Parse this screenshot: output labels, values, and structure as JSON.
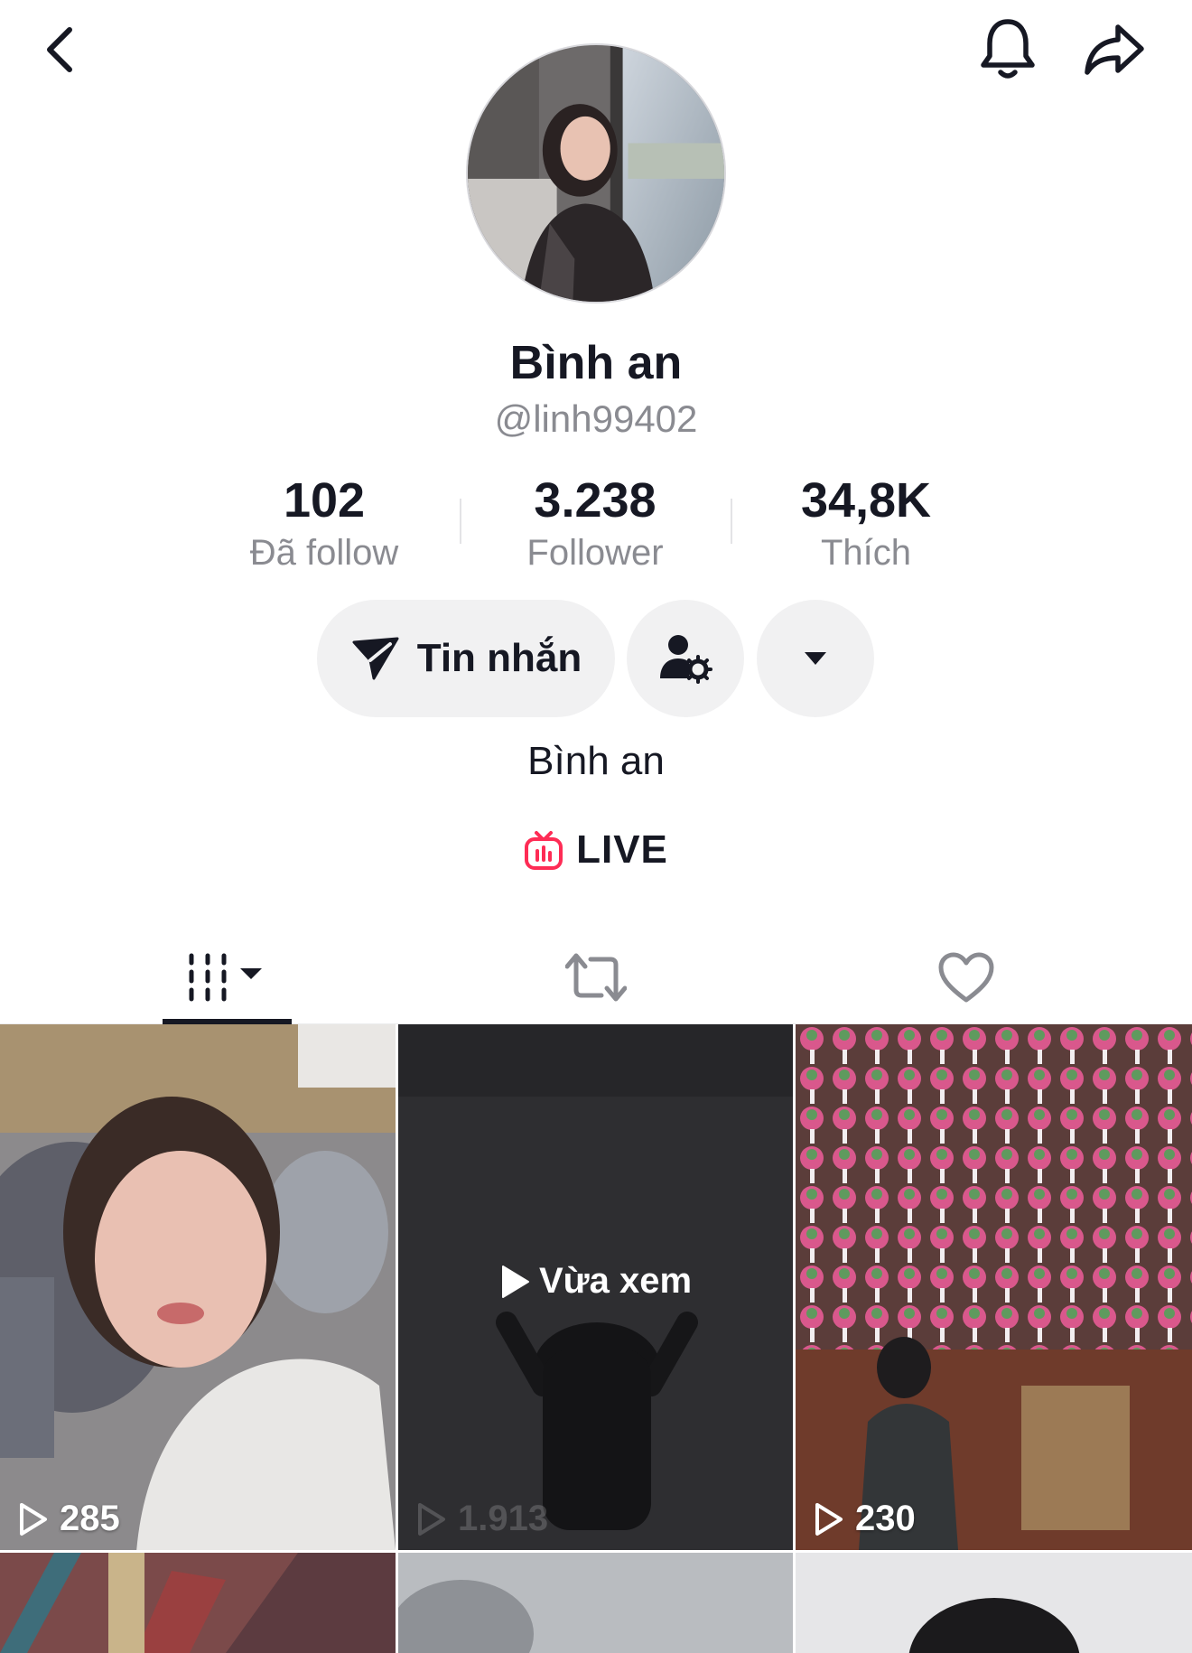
{
  "header": {
    "back_icon": "back-arrow-icon",
    "bell_icon": "bell-icon",
    "share_icon": "share-icon"
  },
  "profile": {
    "display_name": "Bình an",
    "username": "@linh99402",
    "bio": "Bình an",
    "live_label": "LIVE",
    "live_color": "#fe2c55"
  },
  "stats": {
    "following": {
      "value": "102",
      "label": "Đã follow"
    },
    "followers": {
      "value": "3.238",
      "label": "Follower"
    },
    "likes": {
      "value": "34,8K",
      "label": "Thích"
    }
  },
  "actions": {
    "message_label": "Tin nhắn",
    "friend_settings_icon": "user-gear-icon",
    "more_icon": "caret-down-icon"
  },
  "tabs": [
    {
      "name": "videos",
      "icon": "grid-icon",
      "active": true
    },
    {
      "name": "reposts",
      "icon": "repost-icon",
      "active": false
    },
    {
      "name": "liked",
      "icon": "heart-icon",
      "active": false
    }
  ],
  "videos": [
    {
      "views": "285"
    },
    {
      "views": "1.913",
      "overlay": "Vừa xem"
    },
    {
      "views": "230"
    },
    {
      "views": ""
    },
    {
      "views": ""
    },
    {
      "views": ""
    }
  ]
}
